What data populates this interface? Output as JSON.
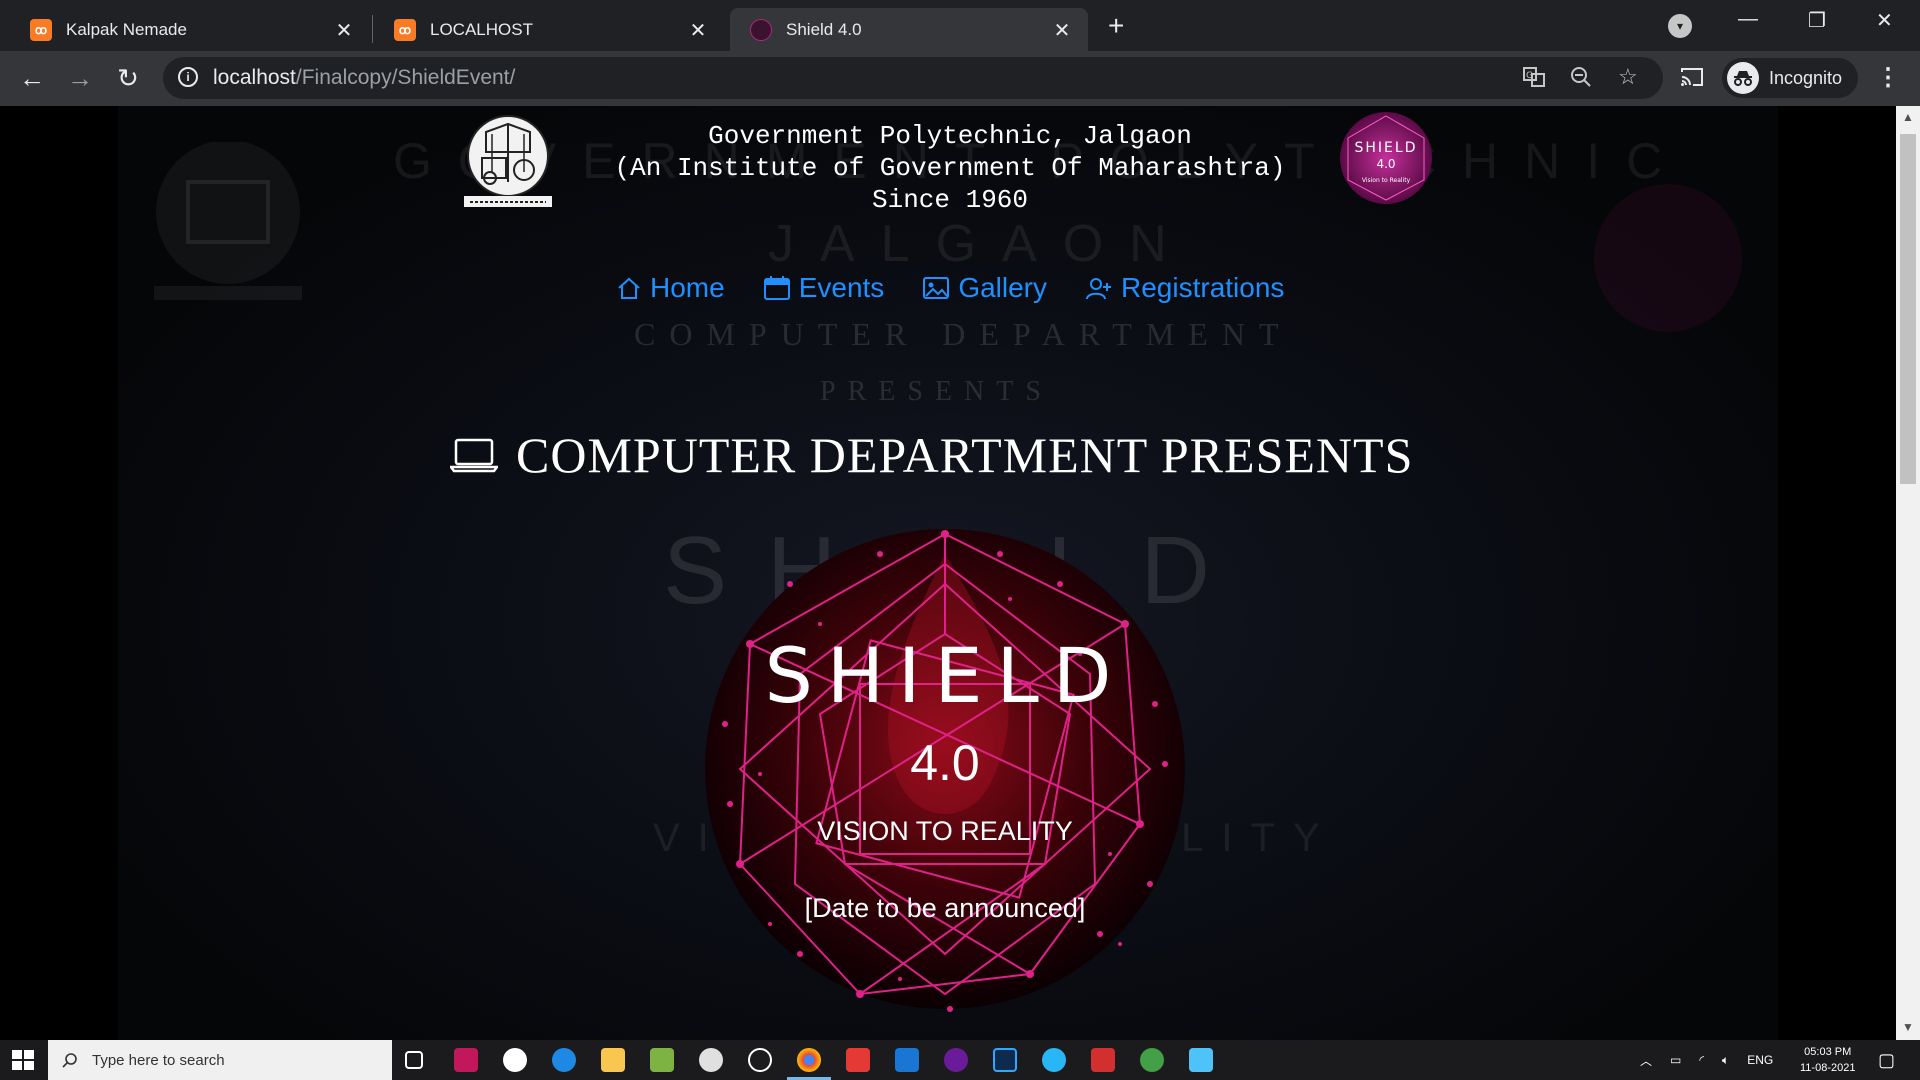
{
  "browser": {
    "tabs": [
      {
        "title": "Kalpak Nemade",
        "favicon": "xampp-icon"
      },
      {
        "title": "LOCALHOST",
        "favicon": "xampp-icon"
      },
      {
        "title": "Shield 4.0",
        "favicon": "shield-icon",
        "active": true
      }
    ],
    "url_host": "localhost",
    "url_path": "/Finalcopy/ShieldEvent/",
    "profile_label": "Incognito"
  },
  "page": {
    "header_lines": [
      "Government Polytechnic, Jalgaon",
      "(An Institute of Government Of Maharashtra)",
      "Since 1960"
    ],
    "nav": [
      {
        "label": "Home",
        "icon": "home-icon"
      },
      {
        "label": "Events",
        "icon": "calendar-icon"
      },
      {
        "label": "Gallery",
        "icon": "image-icon"
      },
      {
        "label": "Registrations",
        "icon": "user-plus-icon"
      }
    ],
    "section_title": "COMPUTER DEPARTMENT PRESENTS",
    "shield_logo": {
      "line1": "SHIELD",
      "line2": "4.0",
      "tagline": "Vision to Reality"
    },
    "emblem": {
      "title": "SHIELD",
      "version": "4.0",
      "tagline": "VISION TO REALITY",
      "date": "[Date to be announced]"
    },
    "background_ghost_text": {
      "line1": "GOVERNMENT POLYTECHNIC",
      "line2": "JALGAON",
      "line3": "COMPUTER DEPARTMENT",
      "line4": "PRESENTS",
      "line5": "SHIELD",
      "line6": "VISION TO REALITY"
    },
    "accent_color": "#1e90ff",
    "emblem_color": "#e0218a"
  },
  "taskbar": {
    "search_placeholder": "Type here to search",
    "language": "ENG",
    "time": "05:03 PM",
    "date": "11-08-2021"
  }
}
